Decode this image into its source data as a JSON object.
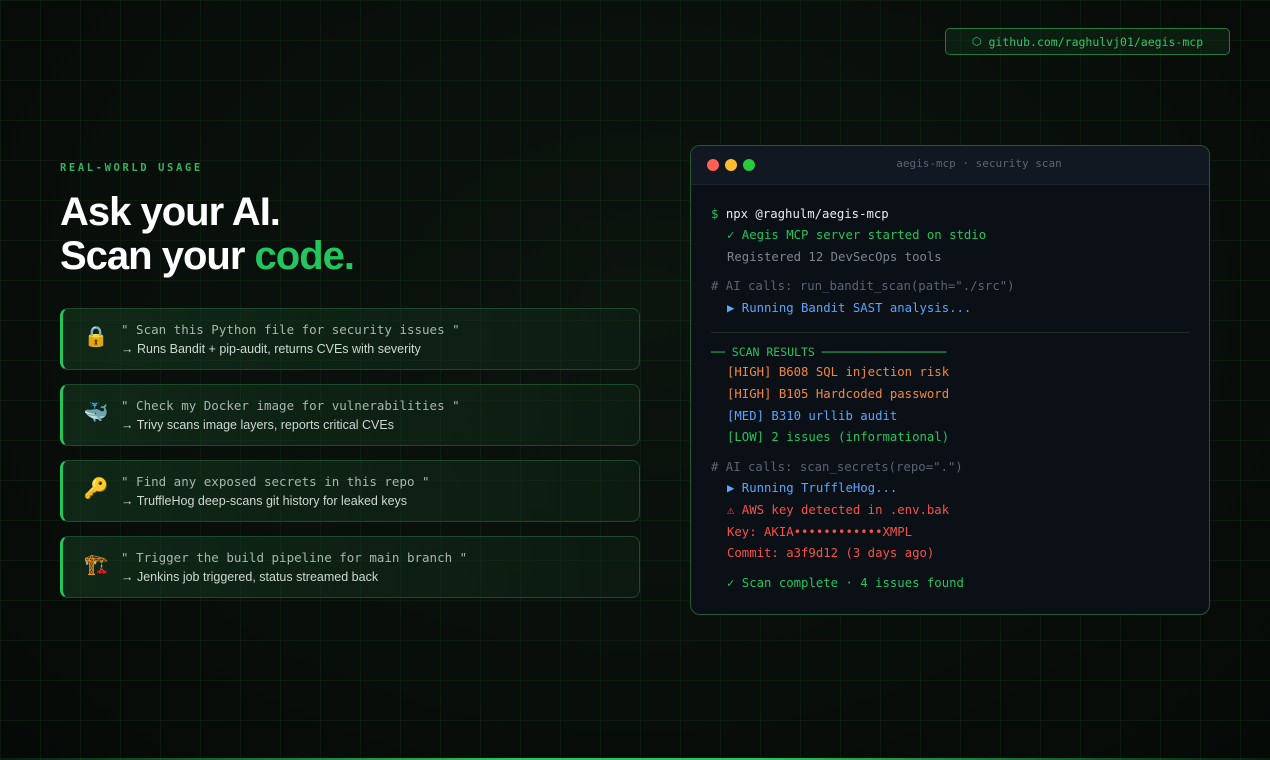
{
  "github_badge": {
    "icon": "github-icon",
    "text": "github.com/raghulvj01/aegis-mcp"
  },
  "hero": {
    "eyebrow": "REAL-WORLD USAGE",
    "line1": "Ask your AI.",
    "line2_prefix": "Scan your ",
    "line2_accent": "code."
  },
  "cards": [
    {
      "icon": "lock-icon",
      "emoji": "🔒",
      "quote": "\" Scan this Python file for security issues \"",
      "desc": "→ Runs Bandit + pip-audit, returns CVEs with severity"
    },
    {
      "icon": "whale-icon",
      "emoji": "🐳",
      "quote": "\" Check my Docker image for vulnerabilities \"",
      "desc": "→ Trivy scans image layers, reports critical CVEs"
    },
    {
      "icon": "key-icon",
      "emoji": "🔑",
      "quote": "\" Find any exposed secrets in this repo \"",
      "desc": "→ TruffleHog deep-scans git history for leaked keys"
    },
    {
      "icon": "crane-icon",
      "emoji": "🏗️",
      "quote": "\" Trigger the build pipeline for main branch \"",
      "desc": "→ Jenkins job triggered, status streamed back"
    }
  ],
  "terminal": {
    "title": "aegis-mcp · security scan",
    "prompt": "$",
    "command": "npx @raghulm/aegis-mcp",
    "server_started": "✓ Aegis MCP server started on stdio",
    "registered": "Registered 12 DevSecOps tools",
    "ai_call_1": "# AI calls: run_bandit_scan(path=\"./src\")",
    "running_bandit": "▶ Running Bandit SAST analysis...",
    "results_header": "── SCAN RESULTS ──────────────────",
    "result_1": "[HIGH] B608 SQL injection risk",
    "result_2": "[HIGH] B105 Hardcoded password",
    "result_3": "[MED] B310 urllib audit",
    "result_4": "[LOW] 2 issues (informational)",
    "ai_call_2": "# AI calls: scan_secrets(repo=\".\")",
    "running_trufflehog": "▶ Running TruffleHog...",
    "aws_warning": "⚠ AWS key detected in .env.bak",
    "key": "Key: AKIA••••••••••••XMPL",
    "commit": "Commit: a3f9d12 (3 days ago)",
    "complete": "✓ Scan complete · 4 issues found"
  },
  "colors": {
    "accent": "#22c55e",
    "high": "#f0883e",
    "med": "#58a6ff",
    "alert": "#f85149",
    "background": "#070c08"
  }
}
